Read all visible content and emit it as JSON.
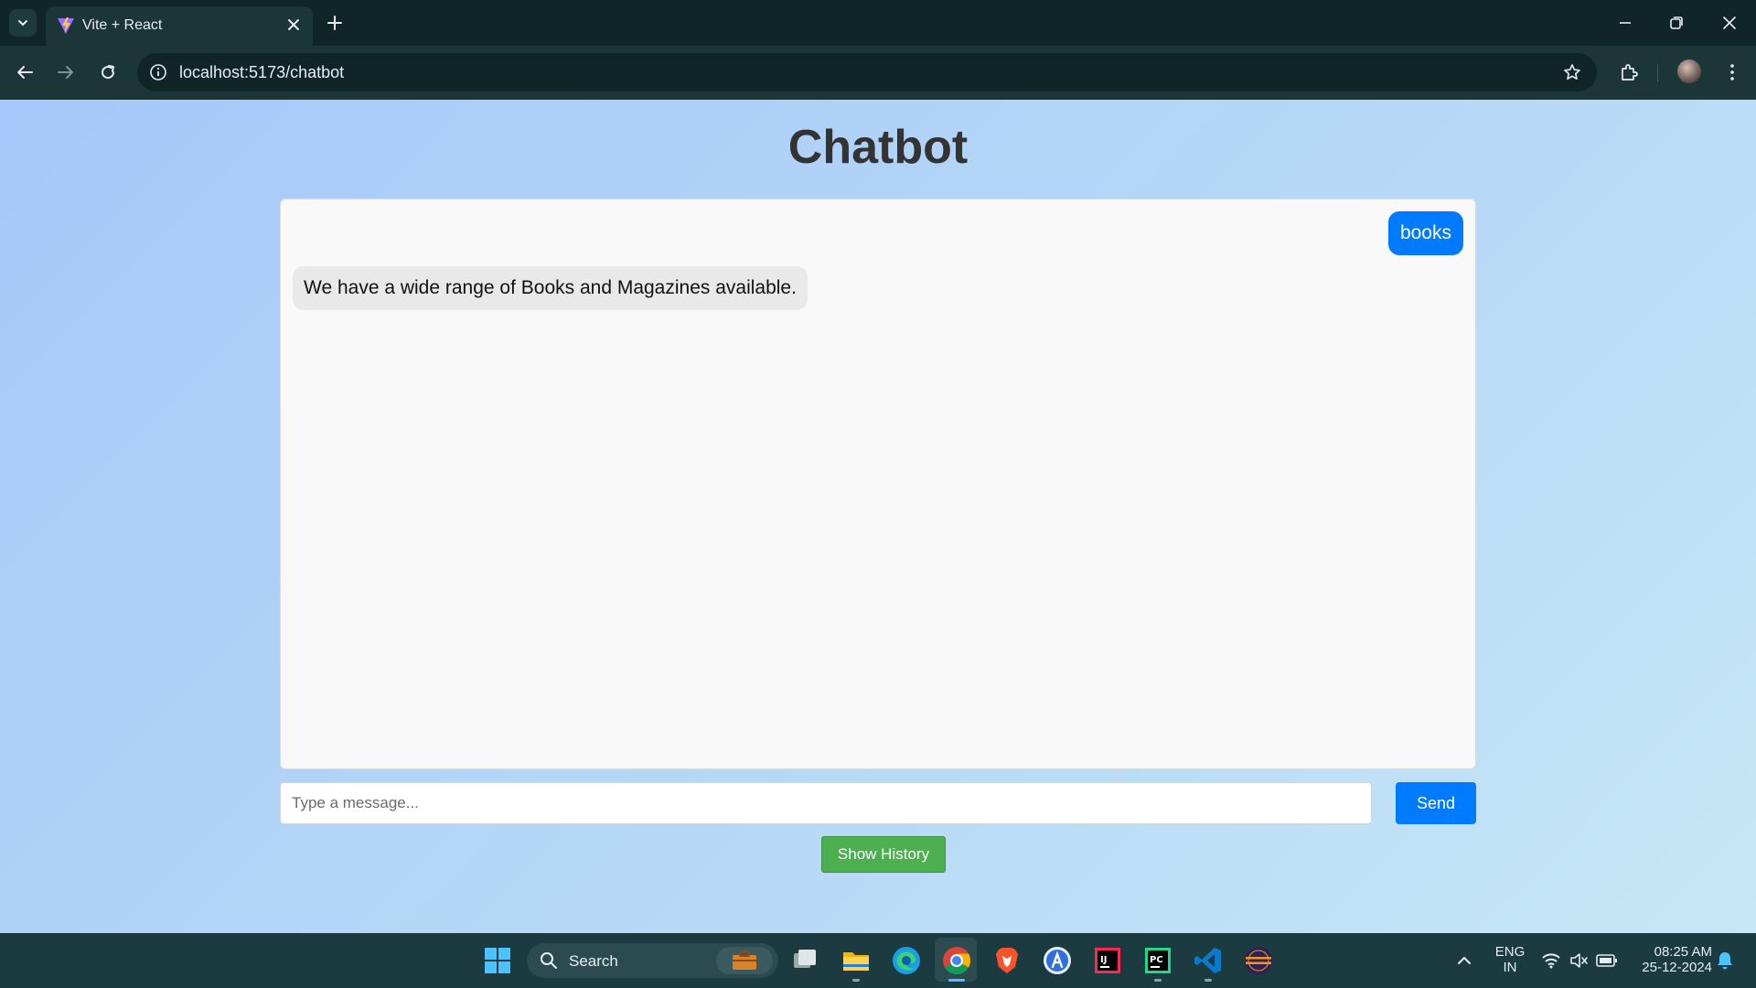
{
  "browser": {
    "tab_title": "Vite + React",
    "url": "localhost:5173/chatbot"
  },
  "page": {
    "title": "Chatbot",
    "messages": [
      {
        "sender": "user",
        "text": "books"
      },
      {
        "sender": "bot",
        "text": "We have a wide range of Books and Magazines available."
      }
    ],
    "input": {
      "placeholder": "Type a message...",
      "value": ""
    },
    "send_label": "Send",
    "history_label": "Show History"
  },
  "taskbar": {
    "search_label": "Search",
    "language_line1": "ENG",
    "language_line2": "IN",
    "time": "08:25 AM",
    "date": "25-12-2024"
  },
  "colors": {
    "accent": "#007bff",
    "history_button": "#4caf50"
  }
}
